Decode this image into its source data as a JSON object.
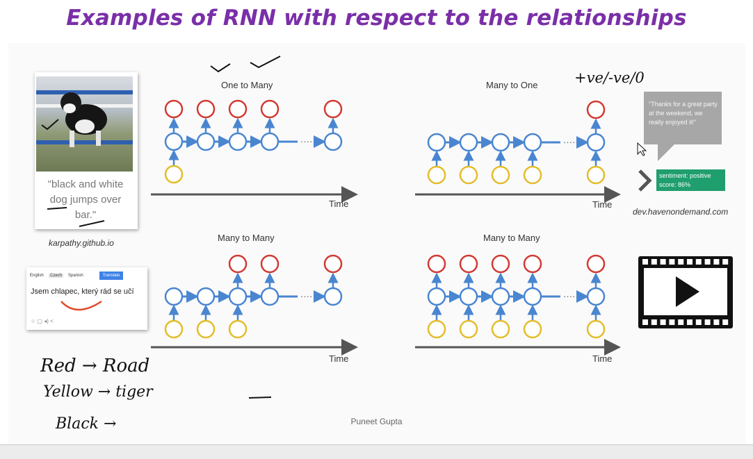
{
  "slide": {
    "title": "Examples of RNN with respect to the relationships",
    "footer": "Puneet Gupta"
  },
  "image_caption": {
    "text": "\"black and white dog jumps over bar.\"",
    "source": "karpathy.github.io"
  },
  "translate_widget": {
    "tabs": [
      "English",
      "Czech",
      "Spanish"
    ],
    "button_label": "Translate",
    "text": "Jsem chlapec, který rád se učí"
  },
  "sentiment": {
    "bubble_text": "\"Thanks for a great party at the weekend, we really enjoyed it!\"",
    "result_line1": "sentiment: positive",
    "result_line2": "score: 86%",
    "source": "dev.havenondemand.com"
  },
  "diagrams": [
    {
      "title": "One to Many",
      "axis_label": "Time"
    },
    {
      "title": "Many to One",
      "axis_label": "Time"
    },
    {
      "title": "Many to Many",
      "axis_label": "Time"
    },
    {
      "title": "Many to Many",
      "axis_label": "Time"
    }
  ],
  "annotations": {
    "top_right": "+ve/-ve/0",
    "line1": "Red → Road",
    "line2": "Yellow → tiger",
    "line3": "Black →"
  },
  "colors": {
    "title": "#7a2fa8",
    "red": "#d23a32",
    "blue": "#4a86d0",
    "yellow": "#e3bd2a",
    "axis": "#555555",
    "sentiment_green": "#1f9e6e"
  }
}
